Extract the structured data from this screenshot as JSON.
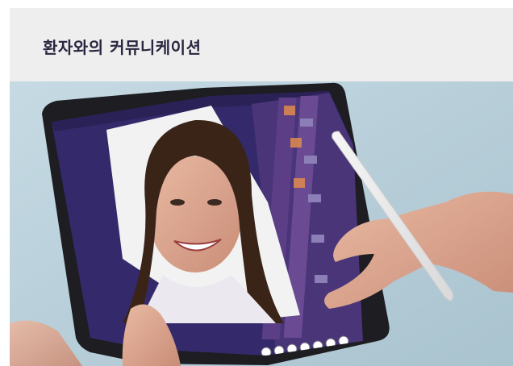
{
  "header": {
    "title": "환자와의 커뮤니케이션"
  },
  "photo": {
    "subject": "tablet-patient-communication",
    "colors": {
      "background": "#bdd3dd",
      "tablet_frame": "#1d1d22",
      "app_background": "#342a6b",
      "panel": "#5b3e86",
      "accent_orange": "#e08a4c"
    }
  }
}
